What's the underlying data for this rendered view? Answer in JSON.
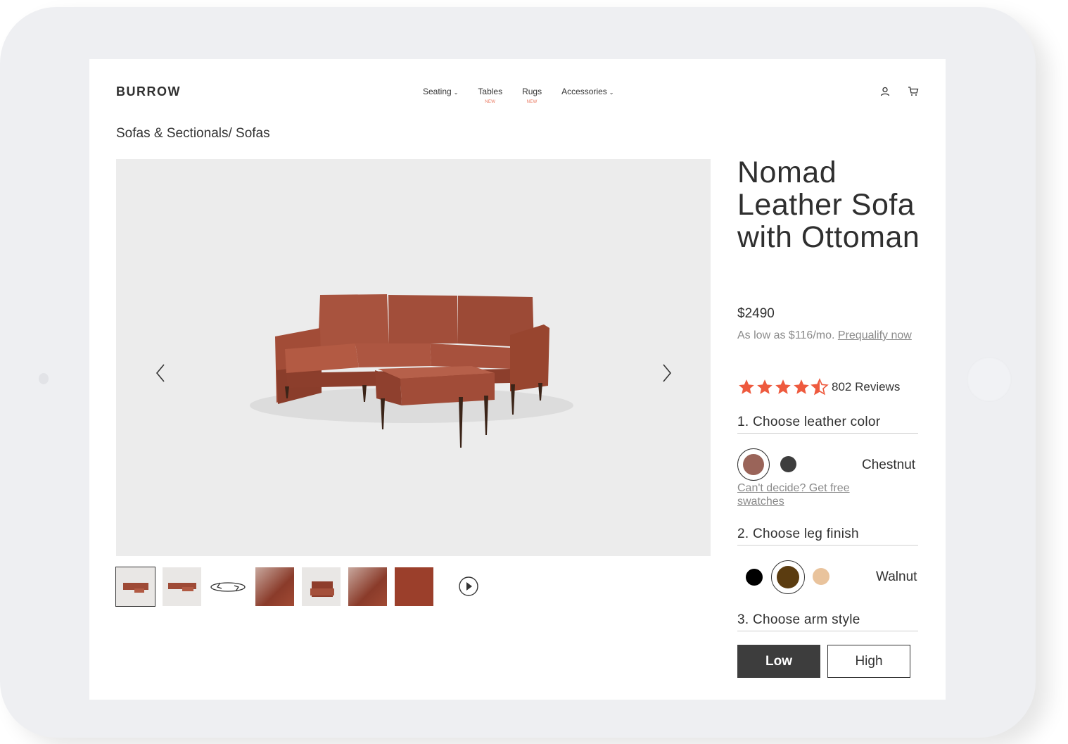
{
  "brand": "BURROW",
  "nav": [
    {
      "label": "Seating",
      "badge": ""
    },
    {
      "label": "Tables",
      "badge": "NEW"
    },
    {
      "label": "Rugs",
      "badge": "NEW"
    },
    {
      "label": "Accessories",
      "badge": ""
    }
  ],
  "breadcrumb": "Sofas & Sectionals/ Sofas",
  "product": {
    "title": "Nomad Leather Sofa with Ottoman",
    "price": "$2490",
    "financing_prefix": "As low as $116/mo.",
    "financing_link": "Prequalify now",
    "rating": 4.5,
    "reviews": "802 Reviews"
  },
  "steps": {
    "color_title": "1. Choose leather color",
    "color_selected": "Chestnut",
    "swatch_link": "Can't decide? Get free swatches",
    "leg_title": "2. Choose leg finish",
    "leg_selected": "Walnut",
    "arm_title": "3. Choose arm style",
    "arm_low": "Low",
    "arm_high": "High"
  },
  "colors": {
    "leather": [
      "#9a6459",
      "#3d3d3d"
    ],
    "legs": [
      "#000000",
      "#5b3c10",
      "#e9c39c"
    ],
    "star": "#ee5a3e",
    "badge": "#e8735a"
  },
  "icons": [
    "account-icon",
    "cart-icon",
    "chevron-left-icon",
    "chevron-right-icon",
    "play-icon",
    "rotate-360-icon"
  ]
}
